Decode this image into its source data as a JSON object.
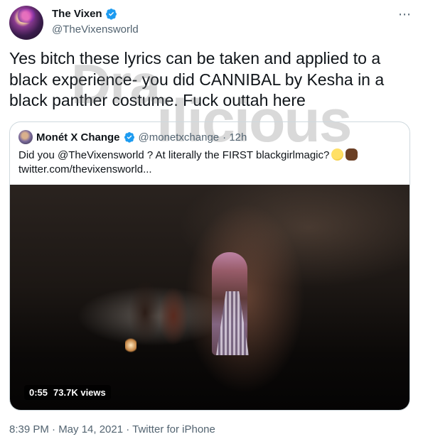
{
  "author": {
    "name": "The Vixen",
    "handle": "@TheVixensworld",
    "verified": true
  },
  "more_icon": "⋯",
  "tweet_text": "Yes bitch these lyrics can be taken and applied to a black experience- you did CANNIBAL by Kesha in a black panther costume. Fuck outtah here",
  "watermark": {
    "line1": "Dra",
    "line2": "ilicious"
  },
  "quote": {
    "name": "Monét X Change",
    "handle": "@monetxchange",
    "time": "· 12h",
    "text": "Did you @TheVixensworld ? At literally the FIRST blackgirlmagic?",
    "link": "twitter.com/thevixensworld...",
    "emoji": [
      "thinking-face",
      "raised-fist-dark"
    ],
    "video": {
      "duration": "0:55",
      "views": "73.7K views"
    }
  },
  "footer": {
    "meta": "8:39 PM · May 14, 2021 · Twitter for iPhone"
  },
  "colors": {
    "verified": "#1d9bf0",
    "secondary_text": "#536471",
    "border": "#cfd9de"
  }
}
